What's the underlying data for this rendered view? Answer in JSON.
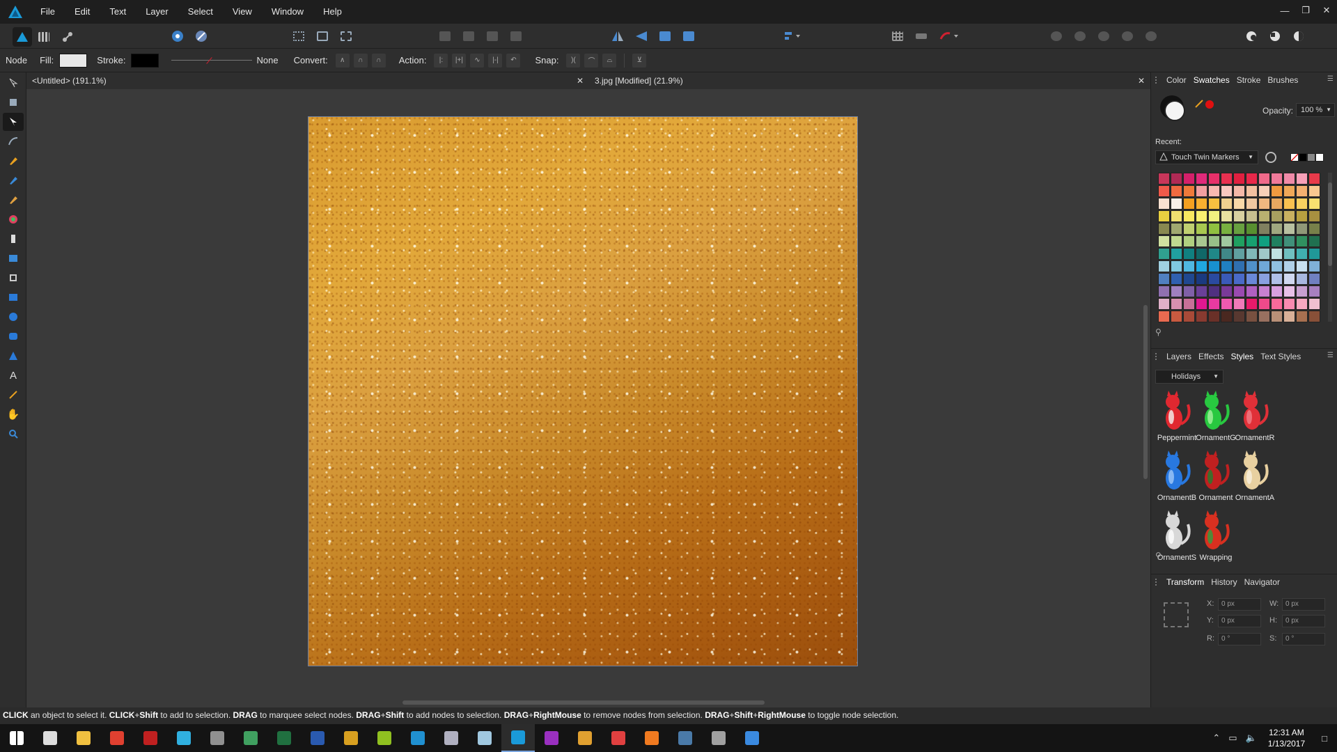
{
  "menubar": {
    "items": [
      "File",
      "Edit",
      "Text",
      "Layer",
      "Select",
      "View",
      "Window",
      "Help"
    ],
    "window_controls": [
      "minimize-icon",
      "restore-icon",
      "close-icon"
    ]
  },
  "contextbar": {
    "tool_label": "Node",
    "fill_label": "Fill:",
    "fill_color": "#e8e8e8",
    "stroke_label": "Stroke:",
    "stroke_color": "#000000",
    "stroke_width_label": "None",
    "convert_label": "Convert:",
    "action_label": "Action:",
    "snap_label": "Snap:"
  },
  "tabs": [
    {
      "label": "<Untitled> (191.1%)"
    },
    {
      "label": "3.jpg [Modified] (21.9%)"
    }
  ],
  "color_panel": {
    "tabs": [
      "Color",
      "Swatches",
      "Stroke",
      "Brushes"
    ],
    "active_tab": "Swatches",
    "opacity_label": "Opacity:",
    "opacity_value": "100 %",
    "recent_label": "Recent:",
    "palette_name": "Touch Twin Markers",
    "swatches": [
      "#c8365a",
      "#b02a55",
      "#d4206a",
      "#e02a7a",
      "#e8306a",
      "#e83050",
      "#e02040",
      "#e8284a",
      "#f06a8a",
      "#f07a9a",
      "#f08aa8",
      "#f8a0b8",
      "#e83a4a",
      "#f05a4a",
      "#f06a40",
      "#f07a3a",
      "#f2a0a0",
      "#f8b8b0",
      "#f8c8c0",
      "#f4b8a8",
      "#f2c0a0",
      "#f8d0b8",
      "#f09a40",
      "#f0a858",
      "#f4b070",
      "#f8c890",
      "#f8e0d0",
      "#f8f0e8",
      "#f4a020",
      "#f8b030",
      "#f8c040",
      "#f0d090",
      "#f8d8a8",
      "#f0c8a0",
      "#f0b880",
      "#e8a860",
      "#f8c050",
      "#f8d060",
      "#f8e070",
      "#e8d040",
      "#f0e070",
      "#f8e860",
      "#f8f070",
      "#f0f080",
      "#e8e0a0",
      "#d8d0a0",
      "#c8c090",
      "#b8b070",
      "#a8a060",
      "#c8b060",
      "#b8a040",
      "#a89040",
      "#888850",
      "#a0a870",
      "#c0d070",
      "#a8c850",
      "#90c040",
      "#78b040",
      "#68a040",
      "#589030",
      "#808060",
      "#a0a880",
      "#b8c0a0",
      "#909878",
      "#78804a",
      "#d0e0a0",
      "#c0d890",
      "#b0d080",
      "#a8c890",
      "#98c088",
      "#a0c8a0",
      "#20a060",
      "#18a070",
      "#10a080",
      "#208060",
      "#40907a",
      "#309060",
      "#207050",
      "#30a090",
      "#20a0a0",
      "#108080",
      "#106868",
      "#208888",
      "#408888",
      "#60a0a0",
      "#80b8b8",
      "#a0c8c8",
      "#c0e0e0",
      "#70c0c0",
      "#40b0b0",
      "#209898",
      "#a0d0e0",
      "#80c8e0",
      "#50b8e0",
      "#20a8e0",
      "#1890d0",
      "#2080c0",
      "#3070b0",
      "#5090c8",
      "#70a8d8",
      "#90c0e0",
      "#b0d0e8",
      "#c8e0f0",
      "#80b0d8",
      "#5080c0",
      "#3060b0",
      "#204890",
      "#1a3a80",
      "#2a4aa0",
      "#3a5ab8",
      "#4a6ac8",
      "#6a88d8",
      "#8aa0e0",
      "#b0c0e8",
      "#d0d8f0",
      "#a8b8e0",
      "#7080c0",
      "#9070b0",
      "#a080c0",
      "#8060a8",
      "#6a4098",
      "#503080",
      "#7a3a98",
      "#9a4ab0",
      "#b060c0",
      "#c880d0",
      "#d8a0e0",
      "#e8c0e8",
      "#c8a0d0",
      "#a880c0",
      "#e0b0c8",
      "#d890b0",
      "#c87098",
      "#e01890",
      "#e83aa0",
      "#f05ab0",
      "#f07ab8",
      "#e81a6a",
      "#f04a8a",
      "#f86a9a",
      "#f88ab0",
      "#f8a8c0",
      "#f0c0d0",
      "#e86a50",
      "#c85a40",
      "#a84a38",
      "#883a30",
      "#6a3028",
      "#4a2820",
      "#583830",
      "#785040",
      "#987060",
      "#b89078",
      "#d8b098",
      "#a87050",
      "#885038"
    ],
    "search_icon": "search-icon"
  },
  "styles_panel": {
    "tabs": [
      "Layers",
      "Effects",
      "Styles",
      "Text Styles"
    ],
    "active_tab": "Styles",
    "category": "Holidays",
    "items": [
      {
        "label": "Peppermint",
        "color": "#e02830",
        "accent": "#f4f4f4"
      },
      {
        "label": "OrnamentG",
        "color": "#28c840",
        "accent": "#a8f0a0"
      },
      {
        "label": "OrnamentR",
        "color": "#e03038",
        "accent": "#f08088"
      },
      {
        "label": "OrnamentB",
        "color": "#2878e0",
        "accent": "#a0c8f8"
      },
      {
        "label": "Ornament",
        "color": "#c02020",
        "accent": "#208030"
      },
      {
        "label": "OrnamentA",
        "color": "#e8d0a0",
        "accent": "#f8f0e0"
      },
      {
        "label": "OrnamentS",
        "color": "#d8d8d8",
        "accent": "#ffffff"
      },
      {
        "label": "Wrapping",
        "color": "#d83020",
        "accent": "#30a040"
      }
    ]
  },
  "transform_panel": {
    "tabs": [
      "Transform",
      "History",
      "Navigator"
    ],
    "active_tab": "Transform",
    "fields": {
      "x_label": "X:",
      "x_value": "0 px",
      "y_label": "Y:",
      "y_value": "0 px",
      "w_label": "W:",
      "w_value": "0 px",
      "h_label": "H:",
      "h_value": "0 px",
      "r_label": "R:",
      "r_value": "0 °",
      "s_label": "S:",
      "s_value": "0 °"
    }
  },
  "statusbar": {
    "segments": [
      {
        "bold": "CLICK",
        "text": " an object to select it. "
      },
      {
        "bold": "CLICK",
        "text": "+"
      },
      {
        "bold": "Shift",
        "text": " to add to selection. "
      },
      {
        "bold": "DRAG",
        "text": " to marquee select nodes. "
      },
      {
        "bold": "DRAG",
        "text": "+"
      },
      {
        "bold": "Shift",
        "text": " to add nodes to selection. "
      },
      {
        "bold": "DRAG",
        "text": "+"
      },
      {
        "bold": "RightMouse",
        "text": " to remove nodes from selection. "
      },
      {
        "bold": "DRAG",
        "text": "+"
      },
      {
        "bold": "Shift",
        "text": "+"
      },
      {
        "bold": "RightMouse",
        "text": " to toggle node selection."
      }
    ]
  },
  "taskbar": {
    "clock_time": "12:31 AM",
    "clock_date": "1/13/2017",
    "apps": [
      {
        "name": "start-icon",
        "color": "#ffffff"
      },
      {
        "name": "task-view-icon",
        "color": "#dddddd"
      },
      {
        "name": "file-explorer-icon",
        "color": "#f0c040"
      },
      {
        "name": "app-red-icon",
        "color": "#e04030"
      },
      {
        "name": "app-shield-icon",
        "color": "#c02020"
      },
      {
        "name": "app-camera-icon",
        "color": "#30b0e0"
      },
      {
        "name": "app-monitor-icon",
        "color": "#909090"
      },
      {
        "name": "app-calendar-icon",
        "color": "#40a060"
      },
      {
        "name": "excel-icon",
        "color": "#207040"
      },
      {
        "name": "word-icon",
        "color": "#2a5ab0"
      },
      {
        "name": "app-gold-icon",
        "color": "#d8a020"
      },
      {
        "name": "app-green-icon",
        "color": "#90c020"
      },
      {
        "name": "app-blue-icon",
        "color": "#2090d0"
      },
      {
        "name": "app-spark-icon",
        "color": "#b0b0c0"
      },
      {
        "name": "app-crystal-icon",
        "color": "#a0c8e0"
      },
      {
        "name": "affinity-designer-icon",
        "color": "#1a9ad8"
      },
      {
        "name": "affinity-photo-icon",
        "color": "#9a30c0"
      },
      {
        "name": "app-color-icon",
        "color": "#e0a030"
      },
      {
        "name": "app-game-icon",
        "color": "#e04040"
      },
      {
        "name": "firefox-icon",
        "color": "#f07a20"
      },
      {
        "name": "steam-icon",
        "color": "#4a7aa8"
      },
      {
        "name": "app-dragon-icon",
        "color": "#a0a0a0"
      },
      {
        "name": "app-blue2-icon",
        "color": "#3a8ae0"
      }
    ]
  }
}
